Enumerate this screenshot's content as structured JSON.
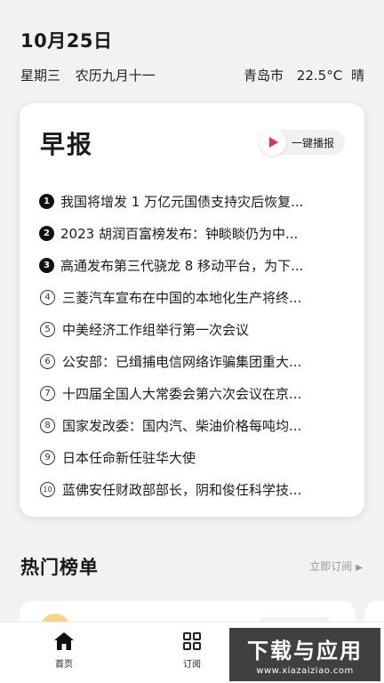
{
  "header": {
    "date": "10月25日",
    "weekday": "星期三",
    "lunar": "农历九月十一",
    "city": "青岛市",
    "temperature": "22.5°C",
    "weather": "晴"
  },
  "briefing": {
    "title": "早报",
    "play_label": "一键播报",
    "items": [
      {
        "num": "1",
        "text": "我国将增发 1 万亿元国债支持灾后恢复..."
      },
      {
        "num": "2",
        "text": "2023 胡润百富榜发布：钟睒睒仍为中..."
      },
      {
        "num": "3",
        "text": "高通发布第三代骁龙 8 移动平台，为下..."
      },
      {
        "num": "4",
        "text": "三菱汽车宣布在中国的本地化生产将终..."
      },
      {
        "num": "5",
        "text": "中美经济工作组举行第一次会议"
      },
      {
        "num": "6",
        "text": "公安部：已缉捕电信网络诈骗集团重大..."
      },
      {
        "num": "7",
        "text": "十四届全国人大常委会第六次会议在京..."
      },
      {
        "num": "8",
        "text": "国家发改委：国内汽、柴油价格每吨均..."
      },
      {
        "num": "9",
        "text": "日本任命新任驻华大使"
      },
      {
        "num": "10",
        "text": "蓝佛安任财政部部长，阴和俊任科学技..."
      }
    ]
  },
  "hot": {
    "title": "热门榜单",
    "subscribe_label": "立即订阅"
  },
  "tabbar": {
    "home_label": "首页",
    "subscribe_label": "订阅"
  },
  "watermark": {
    "title": "下载与应用",
    "url": "www.xiazaiziao.com"
  },
  "colors": {
    "accent_red": "#e7304a",
    "background": "#f2f2f4"
  }
}
